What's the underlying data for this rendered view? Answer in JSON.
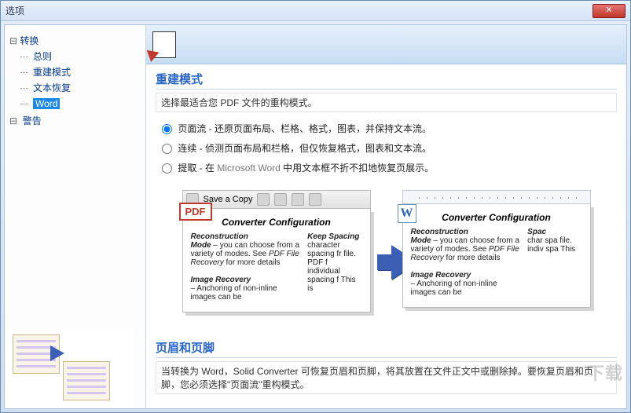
{
  "window": {
    "title": "选项",
    "close_glyph": "✕"
  },
  "tree": {
    "root": "转换",
    "c1": "总则",
    "c2": "重建模式",
    "c3": "文本恢复",
    "c4": "Word",
    "root2": "警告"
  },
  "section1": {
    "title": "重建模式",
    "desc": "选择最适合您 PDF 文件的重构模式。"
  },
  "radios": {
    "r1a": "页面流",
    "r1b": " - 还原页面布局、栏格、格式，图表，并保持文本流。",
    "r2a": "连续",
    "r2b": " - 侦测页面布局和栏格，但仅恢复格式，图表和文本流。",
    "r3a": "提取",
    "r3b1": " - 在 ",
    "r3ms": "Microsoft Word",
    "r3b2": " 中用文本框不折不扣地恢复页展示。"
  },
  "preview": {
    "save": "Save a Copy",
    "pdfbadge": "PDF",
    "wbadge": "W",
    "ptitle": "Converter Configuration",
    "rec_h": "Reconstruction",
    "rec_body1": "Mode",
    "rec_body2": " – you can choose from a variety of modes. See ",
    "rec_body3": "PDF File Recovery",
    "rec_body4": " for more details",
    "img_h": "Image Recovery",
    "img_body": "– Anchoring of non-inline images can be",
    "keep_h": "Keep Spacing",
    "keep_body": "character spacing fr file. PDF f individual spacing f This is",
    "spac_h": "Spac",
    "spac_body": "char spa file. indiv spa This"
  },
  "section2": {
    "title": "页眉和页脚",
    "desc": "当转换为 Word，Solid Converter 可恢复页眉和页脚，将其放置在文件正文中或删除掉。要恢复页眉和页脚，您必须选择\"页面流\"重构模式。"
  },
  "watermark": "下载"
}
